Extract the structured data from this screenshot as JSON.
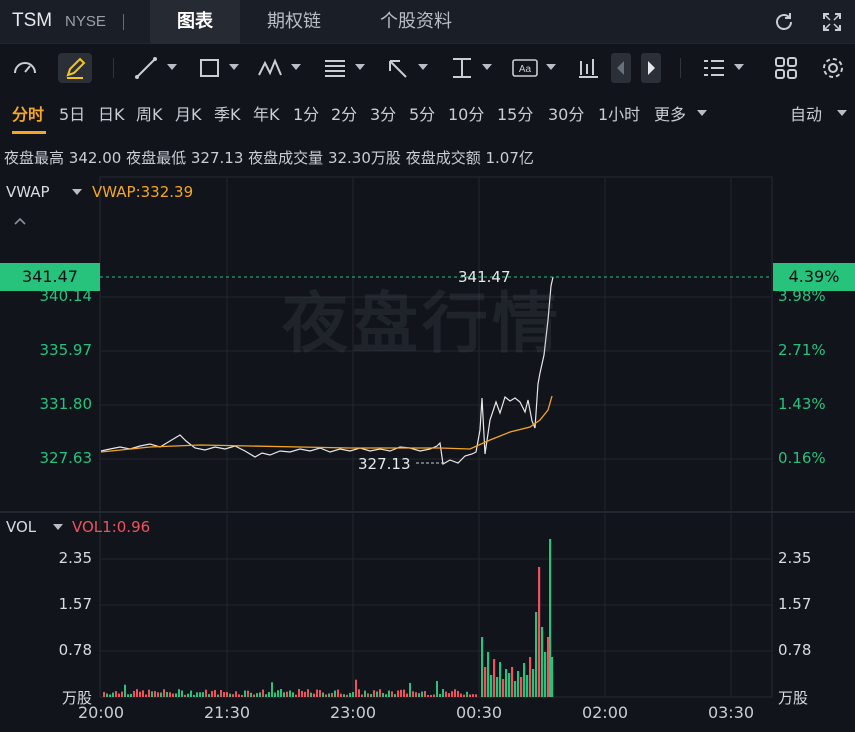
{
  "header": {
    "symbol": "TSM",
    "exchange": "NYSE",
    "tabs": [
      {
        "label": "图表",
        "active": true
      },
      {
        "label": "期权链",
        "active": false
      },
      {
        "label": "个股资料",
        "active": false
      }
    ],
    "icons": [
      "refresh-icon",
      "fullscreen-icon"
    ]
  },
  "toolbar": {
    "icons": [
      "gauge-icon",
      "pencil-icon",
      "trendline-icon",
      "rectangle-icon",
      "pattern-icon",
      "fib-icon",
      "arrow-icon",
      "measure-icon",
      "text-icon",
      "candle-icon",
      "prev-icon",
      "next-icon",
      "layout-icon",
      "grid-icon",
      "settings-icon"
    ]
  },
  "periods": {
    "items": [
      "分时",
      "5日",
      "日K",
      "周K",
      "月K",
      "季K",
      "年K",
      "1分",
      "2分",
      "3分",
      "5分",
      "10分",
      "15分",
      "30分",
      "1小时",
      "更多"
    ],
    "active": "分时",
    "auto": "自动"
  },
  "stats": {
    "high_label": "夜盘最高",
    "high_value": "342.00",
    "low_label": "夜盘最低",
    "low_value": "327.13",
    "vol_label": "夜盘成交量",
    "vol_value": "32.30万股",
    "amt_label": "夜盘成交额",
    "amt_value": "1.07亿"
  },
  "main_pane": {
    "indicator": "VWAP",
    "indicator_value": "VWAP:332.39",
    "price_axis": [
      "340.14",
      "335.97",
      "331.80",
      "327.63"
    ],
    "pct_axis": [
      "3.98%",
      "2.71%",
      "1.43%",
      "0.16%"
    ],
    "current_price": "341.47",
    "current_pct": "4.39%",
    "high_marker": "341.47",
    "low_marker": "327.13",
    "watermark": "夜盘行情"
  },
  "vol_pane": {
    "indicator": "VOL",
    "indicator_value": "VOL1:0.96",
    "axis": [
      "2.35",
      "1.57",
      "0.78"
    ],
    "unit": "万股"
  },
  "time_axis": [
    "20:00",
    "21:30",
    "23:00",
    "00:30",
    "02:00",
    "03:30"
  ],
  "colors": {
    "up": "#27c27c",
    "down": "#f0525c",
    "vwap": "#f5a623",
    "price_line": "#e8e8e8",
    "accent": "#f5a623"
  }
}
